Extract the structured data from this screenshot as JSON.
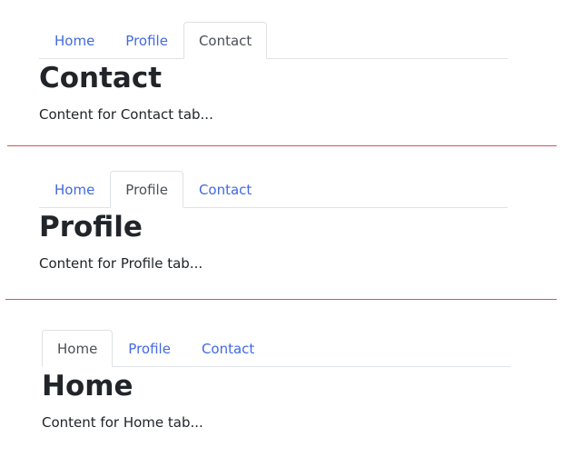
{
  "panels": [
    {
      "tabs": [
        "Home",
        "Profile",
        "Contact"
      ],
      "active": "Contact",
      "heading": "Contact",
      "content": "Content for Contact tab..."
    },
    {
      "tabs": [
        "Home",
        "Profile",
        "Contact"
      ],
      "active": "Profile",
      "heading": "Profile",
      "content": "Content for Profile tab..."
    },
    {
      "tabs": [
        "Home",
        "Profile",
        "Contact"
      ],
      "active": "Home",
      "heading": "Home",
      "content": "Content for Home tab..."
    }
  ],
  "colors": {
    "link": "#4169e1",
    "active_tab_text": "#495057",
    "divider": "#d9534f",
    "border": "#dee2e6"
  }
}
